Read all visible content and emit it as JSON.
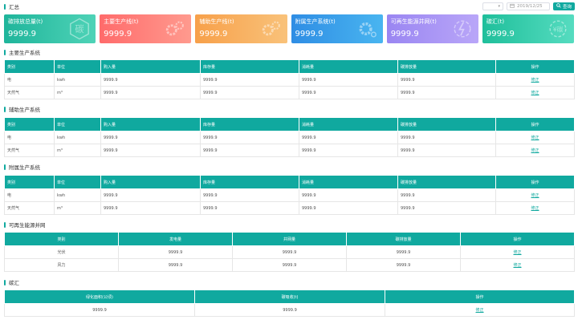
{
  "header": {
    "title": "汇总",
    "select_placeholder": "",
    "date_value": "2019/12/25",
    "query_label": "查询"
  },
  "cards": [
    {
      "title": "碳排放总量(t)",
      "value": "9999.9",
      "color_from": "#1fb59b",
      "color_to": "#4fd3b7",
      "icon": "carbon-char-icon",
      "glyph": "碳"
    },
    {
      "title": "主要生产线(t)",
      "value": "9999.9",
      "color_from": "#ff6b6b",
      "color_to": "#ff9a8e",
      "icon": "gear-icon"
    },
    {
      "title": "辅助生产线(t)",
      "value": "9999.9",
      "color_from": "#f7a04a",
      "color_to": "#f9c27a",
      "icon": "gear-icon"
    },
    {
      "title": "附属生产系统(t)",
      "value": "9999.9",
      "color_from": "#2f8de4",
      "color_to": "#49b5f0",
      "icon": "gear-icon"
    },
    {
      "title": "可再生能源并网(t)",
      "value": "9999.9",
      "color_from": "#9a86f2",
      "color_to": "#b9a6f8",
      "icon": "energy-icon"
    },
    {
      "title": "碳汇(t)",
      "value": "9999.9",
      "color_from": "#1fbf9b",
      "color_to": "#56dcc0",
      "icon": "carbon-sink-icon",
      "glyph": "¥碳"
    }
  ],
  "sections": {
    "main": {
      "title": "主要生产系统"
    },
    "aux": {
      "title": "辅助生产系统"
    },
    "attached": {
      "title": "附属生产系统"
    },
    "renewable": {
      "title": "可再生能源并网"
    },
    "sink": {
      "title": "碳汇"
    }
  },
  "system_table": {
    "headers": [
      "类别",
      "单位",
      "购入量",
      "库存量",
      "消耗量",
      "碳排放量",
      "操作"
    ],
    "rows": [
      [
        "电",
        "kwh",
        "9999.9",
        "9999.9",
        "9999.9",
        "9999.9",
        "修正"
      ],
      [
        "天然气",
        "m³",
        "9999.9",
        "9999.9",
        "9999.9",
        "9999.9",
        "修正"
      ]
    ]
  },
  "renewable_table": {
    "headers": [
      "类别",
      "发电量",
      "并网量",
      "碳排放量",
      "操作"
    ],
    "rows": [
      [
        "光伏",
        "9999.9",
        "9999.9",
        "9999.9",
        "修正"
      ],
      [
        "风力",
        "9999.9",
        "9999.9",
        "9999.9",
        "修正"
      ]
    ]
  },
  "sink_table": {
    "headers": [
      "绿化面积(公顷)",
      "碳吸收(t)",
      "操作"
    ],
    "rows": [
      [
        "9999.9",
        "9999.9",
        "修正"
      ]
    ]
  }
}
